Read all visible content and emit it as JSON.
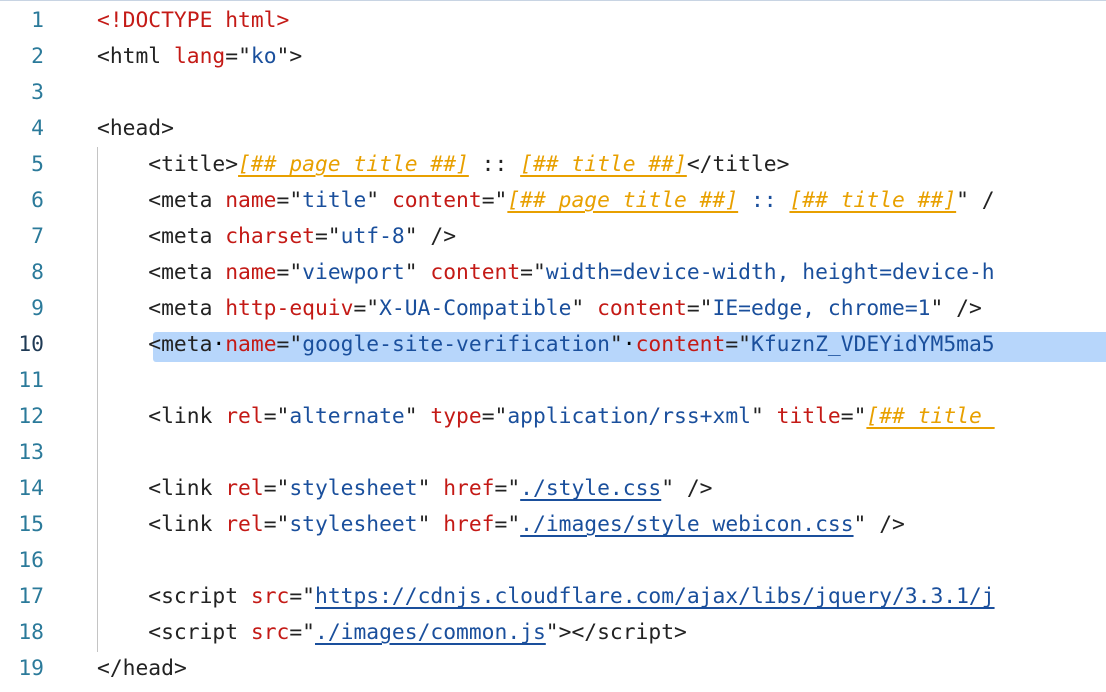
{
  "editor": {
    "active_line": 10,
    "lines": [
      {
        "n": "1",
        "tokens": [
          [
            "doctype",
            "<!DOCTYPE html>"
          ]
        ]
      },
      {
        "n": "2",
        "tokens": [
          [
            "punct",
            "<"
          ],
          [
            "tag",
            "html "
          ],
          [
            "attr",
            "lang"
          ],
          [
            "punct",
            "="
          ],
          [
            "punct",
            "\""
          ],
          [
            "str",
            "ko"
          ],
          [
            "punct",
            "\">"
          ]
        ]
      },
      {
        "n": "3",
        "tokens": []
      },
      {
        "n": "4",
        "tokens": [
          [
            "punct",
            "<"
          ],
          [
            "tag",
            "head"
          ],
          [
            "punct",
            ">"
          ]
        ]
      },
      {
        "n": "5",
        "tokens": [
          [
            "punct",
            "    <"
          ],
          [
            "tag",
            "title"
          ],
          [
            "punct",
            ">"
          ],
          [
            "tpl",
            "[##_page_title_##]"
          ],
          [
            "punct",
            " :: "
          ],
          [
            "tpl",
            "[##_title_##]"
          ],
          [
            "punct",
            "</"
          ],
          [
            "tag",
            "title"
          ],
          [
            "punct",
            ">"
          ]
        ]
      },
      {
        "n": "6",
        "tokens": [
          [
            "punct",
            "    <"
          ],
          [
            "tag",
            "meta "
          ],
          [
            "attr",
            "name"
          ],
          [
            "punct",
            "=\""
          ],
          [
            "str",
            "title"
          ],
          [
            "punct",
            "\" "
          ],
          [
            "attr",
            "content"
          ],
          [
            "punct",
            "=\""
          ],
          [
            "tpl",
            "[##_page_title_##]"
          ],
          [
            "str",
            " :: "
          ],
          [
            "tpl",
            "[##_title_##]"
          ],
          [
            "punct",
            "\" /"
          ]
        ]
      },
      {
        "n": "7",
        "tokens": [
          [
            "punct",
            "    <"
          ],
          [
            "tag",
            "meta "
          ],
          [
            "attr",
            "charset"
          ],
          [
            "punct",
            "=\""
          ],
          [
            "str",
            "utf-8"
          ],
          [
            "punct",
            "\" />"
          ]
        ]
      },
      {
        "n": "8",
        "tokens": [
          [
            "punct",
            "    <"
          ],
          [
            "tag",
            "meta "
          ],
          [
            "attr",
            "name"
          ],
          [
            "punct",
            "=\""
          ],
          [
            "str",
            "viewport"
          ],
          [
            "punct",
            "\" "
          ],
          [
            "attr",
            "content"
          ],
          [
            "punct",
            "=\""
          ],
          [
            "str",
            "width=device-width, height=device-h"
          ]
        ]
      },
      {
        "n": "9",
        "tokens": [
          [
            "punct",
            "    <"
          ],
          [
            "tag",
            "meta "
          ],
          [
            "attr",
            "http-equiv"
          ],
          [
            "punct",
            "=\""
          ],
          [
            "str",
            "X-UA-Compatible"
          ],
          [
            "punct",
            "\" "
          ],
          [
            "attr",
            "content"
          ],
          [
            "punct",
            "=\""
          ],
          [
            "str",
            "IE=edge, chrome=1"
          ],
          [
            "punct",
            "\" />"
          ]
        ]
      },
      {
        "n": "10",
        "tokens": [
          [
            "punct",
            "    <"
          ],
          [
            "tag",
            "meta"
          ],
          [
            "ws",
            "·"
          ],
          [
            "attr",
            "name"
          ],
          [
            "punct",
            "=\""
          ],
          [
            "str",
            "google-site-verification"
          ],
          [
            "punct",
            "\""
          ],
          [
            "ws",
            "·"
          ],
          [
            "attr",
            "content"
          ],
          [
            "punct",
            "=\""
          ],
          [
            "str",
            "KfuznZ_VDEYidYM5ma5"
          ]
        ]
      },
      {
        "n": "11",
        "tokens": []
      },
      {
        "n": "12",
        "tokens": [
          [
            "punct",
            "    <"
          ],
          [
            "tag",
            "link "
          ],
          [
            "attr",
            "rel"
          ],
          [
            "punct",
            "=\""
          ],
          [
            "str",
            "alternate"
          ],
          [
            "punct",
            "\" "
          ],
          [
            "attr",
            "type"
          ],
          [
            "punct",
            "=\""
          ],
          [
            "str",
            "application/rss+xml"
          ],
          [
            "punct",
            "\" "
          ],
          [
            "attr",
            "title"
          ],
          [
            "punct",
            "=\""
          ],
          [
            "tpl",
            "[##_title_"
          ]
        ]
      },
      {
        "n": "13",
        "tokens": []
      },
      {
        "n": "14",
        "tokens": [
          [
            "punct",
            "    <"
          ],
          [
            "tag",
            "link "
          ],
          [
            "attr",
            "rel"
          ],
          [
            "punct",
            "=\""
          ],
          [
            "str",
            "stylesheet"
          ],
          [
            "punct",
            "\" "
          ],
          [
            "attr",
            "href"
          ],
          [
            "punct",
            "=\""
          ],
          [
            "url",
            "./style.css"
          ],
          [
            "punct",
            "\" />"
          ]
        ]
      },
      {
        "n": "15",
        "tokens": [
          [
            "punct",
            "    <"
          ],
          [
            "tag",
            "link "
          ],
          [
            "attr",
            "rel"
          ],
          [
            "punct",
            "=\""
          ],
          [
            "str",
            "stylesheet"
          ],
          [
            "punct",
            "\" "
          ],
          [
            "attr",
            "href"
          ],
          [
            "punct",
            "=\""
          ],
          [
            "url",
            "./images/style_webicon.css"
          ],
          [
            "punct",
            "\" />"
          ]
        ]
      },
      {
        "n": "16",
        "tokens": []
      },
      {
        "n": "17",
        "tokens": [
          [
            "punct",
            "    <"
          ],
          [
            "tag",
            "script "
          ],
          [
            "attr",
            "src"
          ],
          [
            "punct",
            "=\""
          ],
          [
            "url",
            "https://cdnjs.cloudflare.com/ajax/libs/jquery/3.3.1/j"
          ]
        ]
      },
      {
        "n": "18",
        "tokens": [
          [
            "punct",
            "    <"
          ],
          [
            "tag",
            "script "
          ],
          [
            "attr",
            "src"
          ],
          [
            "punct",
            "=\""
          ],
          [
            "url",
            "./images/common.js"
          ],
          [
            "punct",
            "\"></"
          ],
          [
            "tag",
            "script"
          ],
          [
            "punct",
            ">"
          ]
        ]
      },
      {
        "n": "19",
        "tokens": [
          [
            "punct",
            "</"
          ],
          [
            "tag",
            "head"
          ],
          [
            "punct",
            ">"
          ]
        ]
      }
    ]
  }
}
